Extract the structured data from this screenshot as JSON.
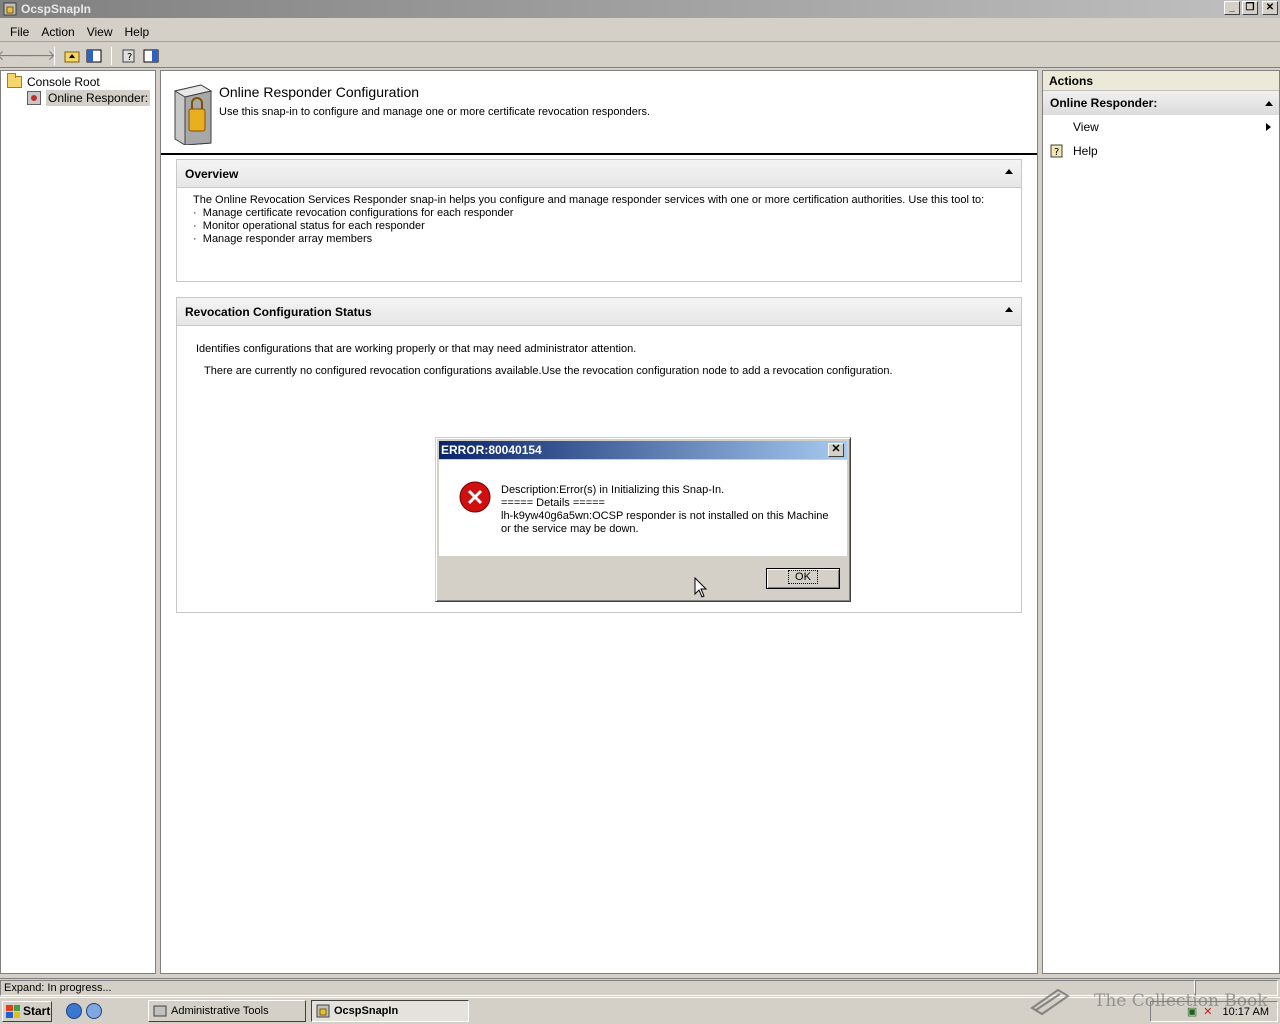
{
  "window": {
    "title": "OcspSnapIn"
  },
  "menu": [
    {
      "label": "File",
      "key": "F"
    },
    {
      "label": "Action",
      "key": "A"
    },
    {
      "label": "View",
      "key": "V"
    },
    {
      "label": "Help",
      "key": "H"
    }
  ],
  "tree": {
    "root": "Console Root",
    "child": "Online Responder:"
  },
  "header": {
    "title": "Online Responder Configuration",
    "subtitle": "Use this snap-in to configure and manage one or more certificate revocation responders."
  },
  "overview": {
    "title": "Overview",
    "intro": "The Online Revocation Services Responder snap-in helps you configure and manage responder services with one or more certification authorities. Use this tool to:",
    "bullets": [
      "Manage certificate revocation configurations for each responder",
      "Monitor operational status for each responder",
      "Manage responder array members"
    ]
  },
  "revocation_status": {
    "title": "Revocation Configuration Status",
    "desc": "Identifies configurations that are working properly or that may need administrator attention.",
    "message": "There are currently no configured revocation configurations available.Use the revocation configuration node to add a revocation configuration."
  },
  "actions": {
    "header": "Actions",
    "group": "Online Responder:",
    "items": [
      "View",
      "Help"
    ]
  },
  "dialog": {
    "title": "ERROR:80040154",
    "line1": "Description:Error(s) in Initializing this Snap-In.",
    "line2": "===== Details =====",
    "line3": "lh-k9yw40g6a5wn:OCSP responder is not installed on this Machine",
    "line4": "or the service may be down.",
    "ok": "OK"
  },
  "status": {
    "text": "Expand:  In progress..."
  },
  "taskbar": {
    "start": "Start",
    "tasks": [
      "Administrative Tools",
      "OcspSnapIn"
    ],
    "clock": "10:17 AM"
  },
  "watermark": "The Collection Book"
}
